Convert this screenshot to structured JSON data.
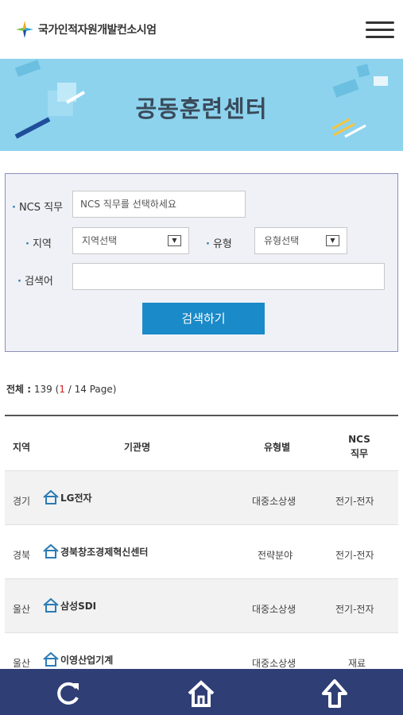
{
  "header": {
    "org_name": "국가인적자원개발컨소시엄",
    "logo_icon": "consortium-logo-icon",
    "menu_icon": "hamburger-menu-icon"
  },
  "banner": {
    "title": "공동훈련센터"
  },
  "search": {
    "ncs_label": "NCS 직무",
    "ncs_placeholder": "NCS 직무를 선택하세요",
    "region_label": "지역",
    "region_value": "지역선택",
    "type_label": "유형",
    "type_value": "유형선택",
    "keyword_label": "검색어",
    "keyword_value": "",
    "button_label": "검색하기"
  },
  "summary": {
    "total_label": "전체 :",
    "total_count": "139",
    "open_paren": "(",
    "current_page": "1",
    "page_rest": "/ 14 Page)"
  },
  "table": {
    "headers": {
      "region": "지역",
      "org": "기관명",
      "type": "유형별",
      "ncs_line1": "NCS",
      "ncs_line2": "직무"
    },
    "rows": [
      {
        "region": "경기",
        "org": "LG전자",
        "type": "대중소상생",
        "ncs": "전기-전자"
      },
      {
        "region": "경북",
        "org": "경북창조경제혁신센터",
        "type": "전략분야",
        "ncs": "전기-전자"
      },
      {
        "region": "울산",
        "org": "삼성SDI",
        "type": "대중소상생",
        "ncs": "전기-전자"
      },
      {
        "region": "울산",
        "org": "이영산업기계",
        "type": "대중소상생",
        "ncs": "재료"
      }
    ]
  },
  "bottom_nav": {
    "refresh_icon": "refresh-icon",
    "home_icon": "home-icon",
    "top_icon": "arrow-up-icon"
  },
  "colors": {
    "banner": "#8dd3ee",
    "accent": "#1a8ac8",
    "bottom_bar": "#2f3e75",
    "page_current": "#d02020"
  }
}
